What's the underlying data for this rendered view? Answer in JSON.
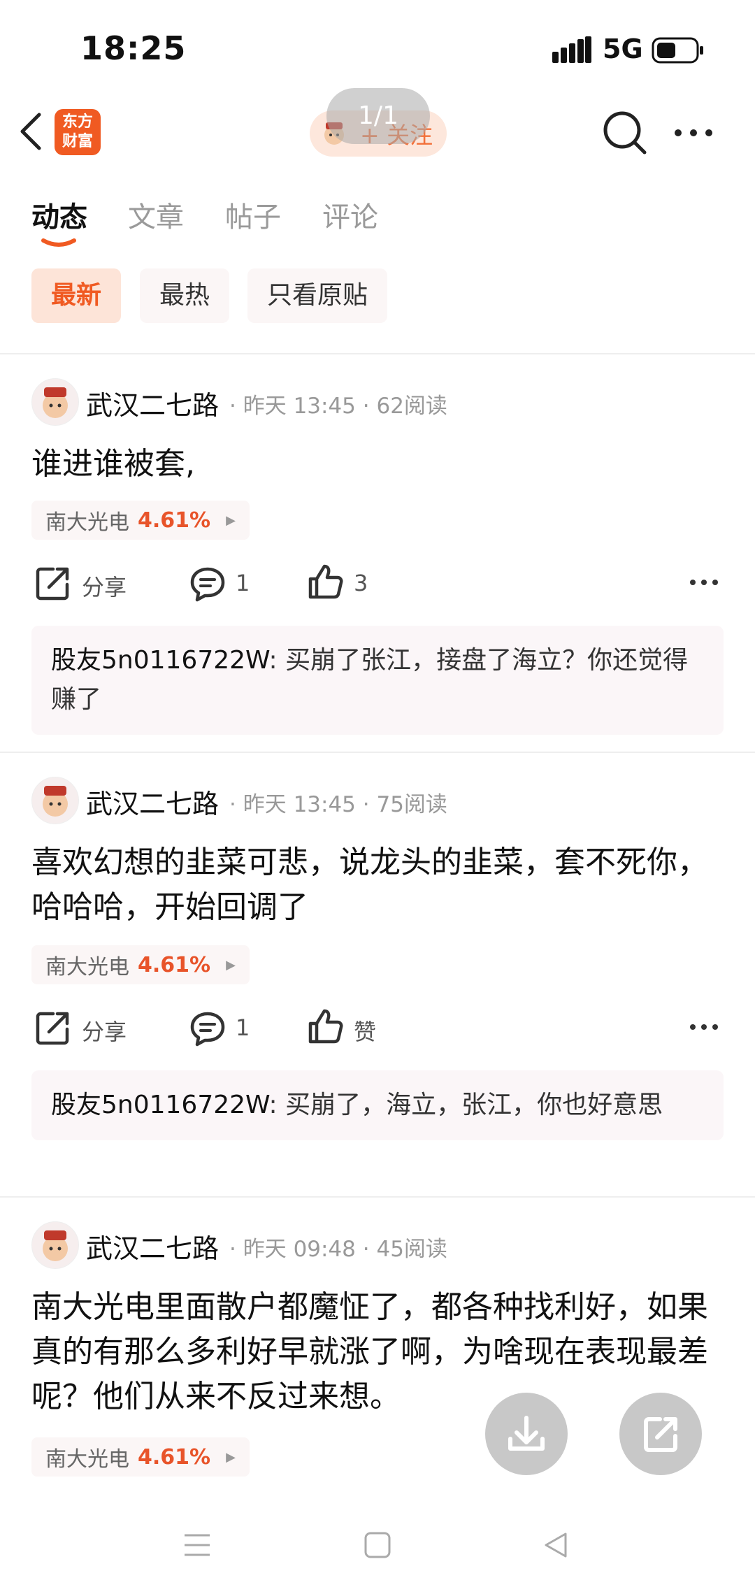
{
  "status_bar": {
    "time": "18:25",
    "network": "5G"
  },
  "header": {
    "logo_line1": "东方",
    "logo_line2": "财富",
    "follow_label": "+ 关注",
    "page_indicator": "1/1"
  },
  "tabs": [
    {
      "label": "动态",
      "active": true
    },
    {
      "label": "文章",
      "active": false
    },
    {
      "label": "帖子",
      "active": false
    },
    {
      "label": "评论",
      "active": false
    }
  ],
  "filters": [
    {
      "label": "最新",
      "active": true
    },
    {
      "label": "最热",
      "active": false
    },
    {
      "label": "只看原贴",
      "active": false
    }
  ],
  "posts": [
    {
      "author": "武汉二七路",
      "time": "昨天 13:45",
      "reads": "62阅读",
      "text": "谁进谁被套,",
      "stock_name": "南大光电",
      "stock_change": "4.61%",
      "share_label": "分享",
      "comments": "1",
      "likes": "3",
      "reply_user": "股友5n0116722W",
      "reply_sep": ":",
      "reply_text": "买崩了张江，接盘了海立？你还觉得赚了"
    },
    {
      "author": "武汉二七路",
      "time": "昨天 13:45",
      "reads": "75阅读",
      "text": "喜欢幻想的韭菜可悲，说龙头的韭菜，套不死你，哈哈哈，开始回调了",
      "stock_name": "南大光电",
      "stock_change": "4.61%",
      "share_label": "分享",
      "comments": "1",
      "likes": "赞",
      "reply_user": "股友5n0116722W",
      "reply_sep": ":",
      "reply_text": "买崩了，海立，张江，你也好意思"
    },
    {
      "author": "武汉二七路",
      "time": "昨天 09:48",
      "reads": "45阅读",
      "text": "南大光电里面散户都魔怔了，都各种找利好，如果真的有那么多利好早就涨了啊，为啥现在表现最差呢？他们从来不反过来想。",
      "stock_name": "南大光电",
      "stock_change": "4.61%"
    }
  ],
  "colors": {
    "accent": "#f05a22",
    "stock_up": "#e8542a"
  }
}
